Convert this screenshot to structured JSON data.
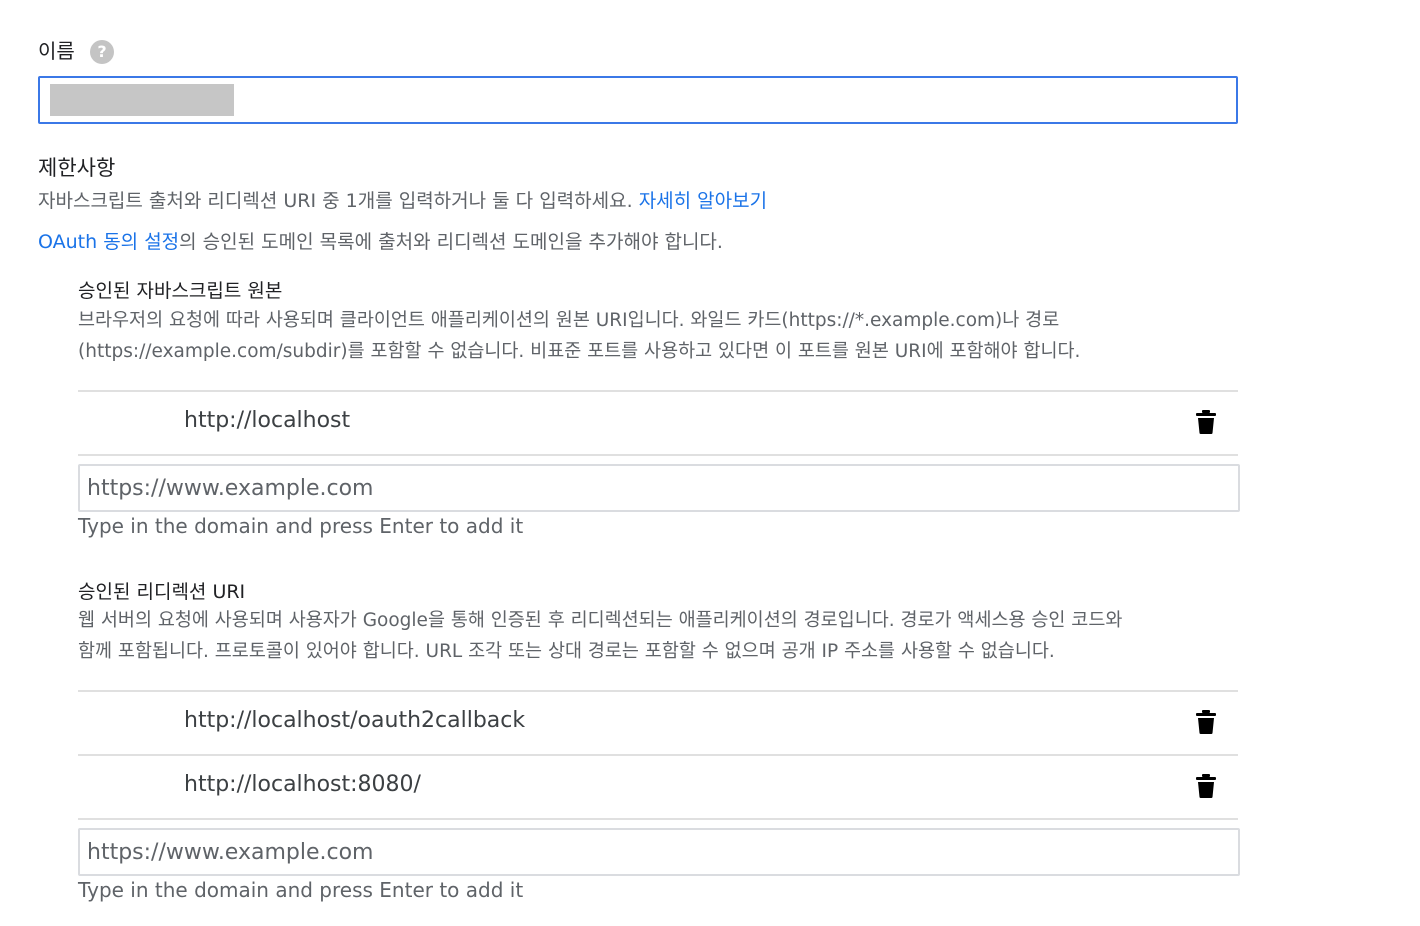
{
  "name_field": {
    "label": "이름",
    "help_icon": "help-circle-icon",
    "value": ""
  },
  "restrictions": {
    "title": "제한사항",
    "description": "자바스크립트 출처와 리디렉션 URI 중 1개를 입력하거나 둘 다 입력하세요.",
    "learn_more_link": "자세히 알아보기",
    "consent_link": "OAuth 동의 설정",
    "consent_text": "의 승인된 도메인 목록에 출처와 리디렉션 도메인을 추가해야 합니다."
  },
  "js_origins": {
    "title": "승인된 자바스크립트 원본",
    "description_line1": "브라우저의 요청에 따라 사용되며 클라이언트 애플리케이션의 원본 URI입니다. 와일드 카드(https://*.example.com)나 경로",
    "description_line2": "(https://example.com/subdir)를 포함할 수 없습니다. 비표준 포트를 사용하고 있다면 이 포트를 원본 URI에 포함해야 합니다.",
    "items": [
      {
        "uri": "http://localhost",
        "delete_icon": "trash-icon"
      }
    ],
    "input_placeholder": "https://www.example.com",
    "hint": "Type in the domain and press Enter to add it"
  },
  "redirect_uris": {
    "title": "승인된 리디렉션 URI",
    "description_line1": "웹 서버의 요청에 사용되며 사용자가 Google을 통해 인증된 후 리디렉션되는 애플리케이션의 경로입니다. 경로가 액세스용 승인 코드와",
    "description_line2": "함께 포함됩니다. 프로토콜이 있어야 합니다. URL 조각 또는 상대 경로는 포함할 수 없으며 공개 IP 주소를 사용할 수 없습니다.",
    "items": [
      {
        "uri": "http://localhost/oauth2callback",
        "delete_icon": "trash-icon"
      },
      {
        "uri": "http://localhost:8080/",
        "delete_icon": "trash-icon"
      }
    ],
    "input_placeholder": "https://www.example.com",
    "hint": "Type in the domain and press Enter to add it"
  },
  "colors": {
    "link": "#1a73e8",
    "focus_border": "#3b78e7",
    "muted_text": "#5f6368"
  }
}
